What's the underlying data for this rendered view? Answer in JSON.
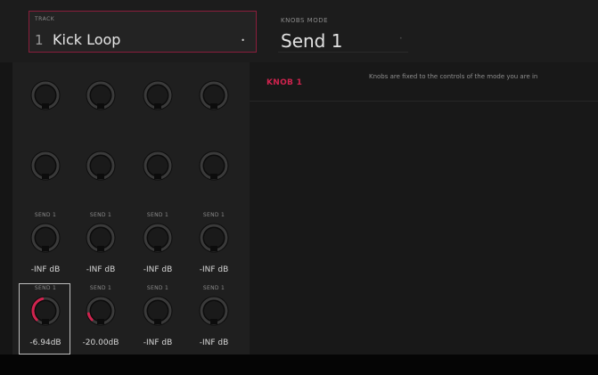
{
  "track": {
    "caption": "TRACK",
    "number": "1",
    "name": "Kick Loop",
    "dropdown_icon": "dropdown-dot"
  },
  "knobs_mode": {
    "caption": "KNOBS MODE",
    "value": "Send 1"
  },
  "info": {
    "knob_title": "KNOB 1",
    "description": "Knobs are fixed to the controls of the mode you are in"
  },
  "colors": {
    "accent": "#d0234e",
    "panel": "#1f1f1f",
    "background": "#151515"
  },
  "knob_rows": [
    {
      "send_labels": null,
      "value_labels": null,
      "fills": [
        0,
        0,
        0,
        0
      ]
    },
    {
      "send_labels": null,
      "value_labels": null,
      "fills": [
        0,
        0,
        0,
        0
      ]
    },
    {
      "send_labels": [
        "SEND 1",
        "SEND 1",
        "SEND 1",
        "SEND 1"
      ],
      "value_labels": [
        "-INF dB",
        "-INF dB",
        "-INF dB",
        "-INF dB"
      ],
      "fills": [
        0,
        0,
        0,
        0
      ]
    },
    {
      "send_labels": [
        "SEND 1",
        "SEND 1",
        "SEND 1",
        "SEND 1"
      ],
      "value_labels": [
        "-6.94dB",
        "-20.00dB",
        "-INF dB",
        "-INF dB"
      ],
      "fills": [
        0.45,
        0.12,
        0,
        0
      ]
    }
  ]
}
